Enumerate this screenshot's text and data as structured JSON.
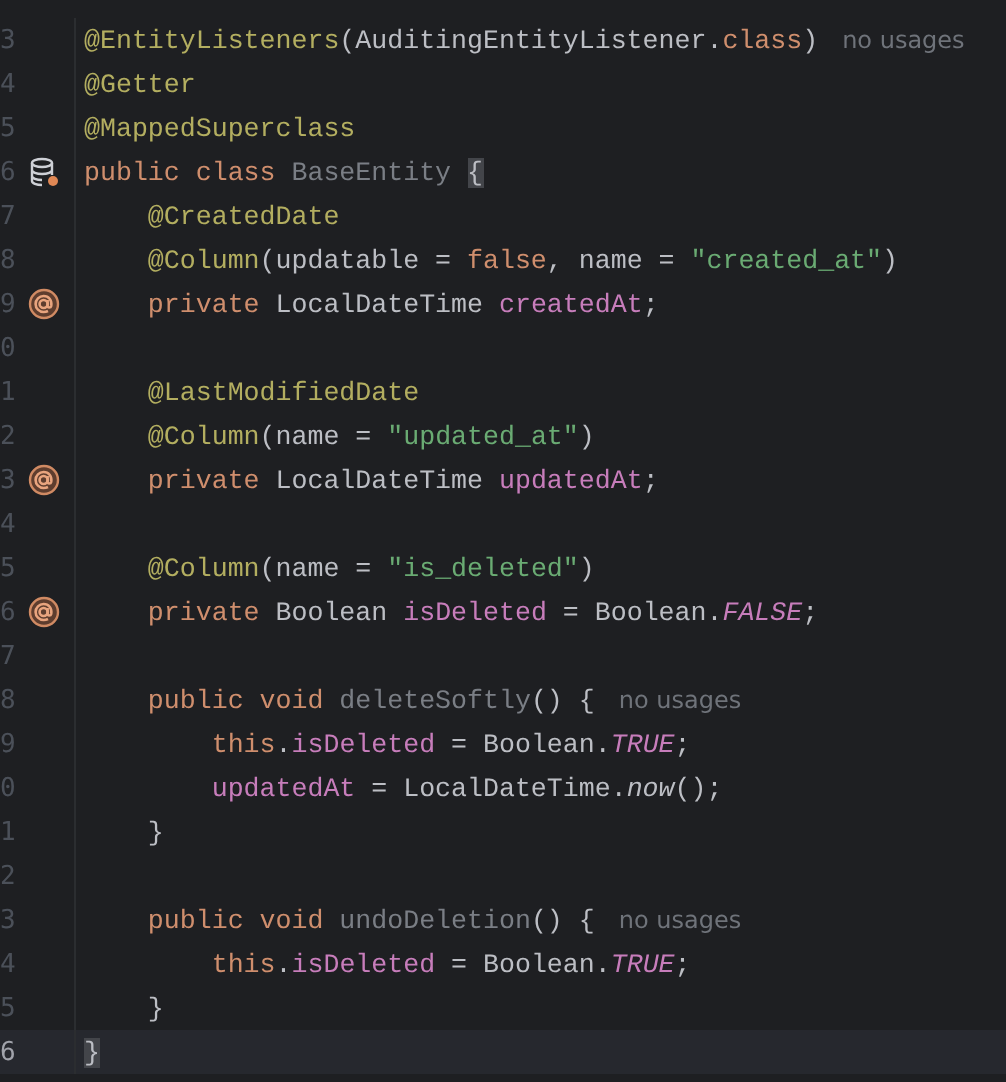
{
  "editor": {
    "lines": [
      {
        "number": "3",
        "current": false,
        "tokens": [
          {
            "kind": "annotation",
            "text": "@EntityListeners"
          },
          {
            "kind": "plain",
            "text": "(AuditingEntityListener."
          },
          {
            "kind": "keyword",
            "text": "class"
          },
          {
            "kind": "plain",
            "text": ")"
          }
        ],
        "hint": "no usages"
      },
      {
        "number": "4",
        "current": false,
        "tokens": [
          {
            "kind": "annotation",
            "text": "@Getter"
          }
        ]
      },
      {
        "number": "5",
        "current": false,
        "tokens": [
          {
            "kind": "annotation",
            "text": "@MappedSuperclass"
          }
        ]
      },
      {
        "number": "6",
        "current": false,
        "gutter_marker": {
          "kind": "database"
        },
        "tokens": [
          {
            "kind": "keyword",
            "text": "public class "
          },
          {
            "kind": "unused",
            "text": "BaseEntity "
          },
          {
            "kind": "brace_match",
            "text": "{"
          }
        ]
      },
      {
        "number": "7",
        "current": false,
        "tokens": [
          {
            "kind": "annotation",
            "text": "    @CreatedDate"
          }
        ]
      },
      {
        "number": "8",
        "current": false,
        "tokens": [
          {
            "kind": "annotation",
            "text": "    @Column"
          },
          {
            "kind": "plain",
            "text": "(updatable = "
          },
          {
            "kind": "keyword",
            "text": "false"
          },
          {
            "kind": "plain",
            "text": ", name = "
          },
          {
            "kind": "string",
            "text": "\"created_at\""
          },
          {
            "kind": "plain",
            "text": ")"
          }
        ]
      },
      {
        "number": "9",
        "current": false,
        "gutter_marker": {
          "kind": "annotated"
        },
        "tokens": [
          {
            "kind": "keyword",
            "text": "    private "
          },
          {
            "kind": "plain",
            "text": "LocalDateTime "
          },
          {
            "kind": "field",
            "text": "createdAt"
          },
          {
            "kind": "plain",
            "text": ";"
          }
        ]
      },
      {
        "number": "0",
        "current": false
      },
      {
        "number": "1",
        "current": false,
        "tokens": [
          {
            "kind": "annotation",
            "text": "    @LastModifiedDate"
          }
        ]
      },
      {
        "number": "2",
        "current": false,
        "tokens": [
          {
            "kind": "annotation",
            "text": "    @Column"
          },
          {
            "kind": "plain",
            "text": "(name = "
          },
          {
            "kind": "string",
            "text": "\"updated_at\""
          },
          {
            "kind": "plain",
            "text": ")"
          }
        ]
      },
      {
        "number": "3",
        "current": false,
        "gutter_marker": {
          "kind": "annotated"
        },
        "tokens": [
          {
            "kind": "keyword",
            "text": "    private "
          },
          {
            "kind": "plain",
            "text": "LocalDateTime "
          },
          {
            "kind": "field",
            "text": "updatedAt"
          },
          {
            "kind": "plain",
            "text": ";"
          }
        ]
      },
      {
        "number": "4",
        "current": false
      },
      {
        "number": "5",
        "current": false,
        "tokens": [
          {
            "kind": "annotation",
            "text": "    @Column"
          },
          {
            "kind": "plain",
            "text": "(name = "
          },
          {
            "kind": "string",
            "text": "\"is_deleted\""
          },
          {
            "kind": "plain",
            "text": ")"
          }
        ]
      },
      {
        "number": "6",
        "current": false,
        "gutter_marker": {
          "kind": "annotated"
        },
        "tokens": [
          {
            "kind": "keyword",
            "text": "    private "
          },
          {
            "kind": "plain",
            "text": "Boolean "
          },
          {
            "kind": "field",
            "text": "isDeleted"
          },
          {
            "kind": "plain",
            "text": " = Boolean."
          },
          {
            "kind": "constant",
            "text": "FALSE"
          },
          {
            "kind": "plain",
            "text": ";"
          }
        ]
      },
      {
        "number": "7",
        "current": false
      },
      {
        "number": "8",
        "current": false,
        "tokens": [
          {
            "kind": "keyword",
            "text": "    public void "
          },
          {
            "kind": "unused",
            "text": "deleteSoftly"
          },
          {
            "kind": "plain",
            "text": "() {"
          }
        ],
        "hint": "no usages"
      },
      {
        "number": "9",
        "current": false,
        "tokens": [
          {
            "kind": "keyword",
            "text": "        this"
          },
          {
            "kind": "plain",
            "text": "."
          },
          {
            "kind": "field",
            "text": "isDeleted"
          },
          {
            "kind": "plain",
            "text": " = Boolean."
          },
          {
            "kind": "constant",
            "text": "TRUE"
          },
          {
            "kind": "plain",
            "text": ";"
          }
        ]
      },
      {
        "number": "0",
        "current": false,
        "tokens": [
          {
            "kind": "field",
            "text": "        updatedAt"
          },
          {
            "kind": "plain",
            "text": " = LocalDateTime."
          },
          {
            "kind": "static_call",
            "text": "now"
          },
          {
            "kind": "plain",
            "text": "();"
          }
        ]
      },
      {
        "number": "1",
        "current": false,
        "tokens": [
          {
            "kind": "plain",
            "text": "    }"
          }
        ]
      },
      {
        "number": "2",
        "current": false
      },
      {
        "number": "3",
        "current": false,
        "tokens": [
          {
            "kind": "keyword",
            "text": "    public void "
          },
          {
            "kind": "unused",
            "text": "undoDeletion"
          },
          {
            "kind": "plain",
            "text": "() {"
          }
        ],
        "hint": "no usages"
      },
      {
        "number": "4",
        "current": false,
        "tokens": [
          {
            "kind": "keyword",
            "text": "        this"
          },
          {
            "kind": "plain",
            "text": "."
          },
          {
            "kind": "field",
            "text": "isDeleted"
          },
          {
            "kind": "plain",
            "text": " = Boolean."
          },
          {
            "kind": "constant",
            "text": "TRUE"
          },
          {
            "kind": "plain",
            "text": ";"
          }
        ]
      },
      {
        "number": "5",
        "current": false,
        "tokens": [
          {
            "kind": "plain",
            "text": "    }"
          }
        ]
      },
      {
        "number": "6",
        "current": true,
        "tokens": [
          {
            "kind": "brace_match",
            "text": "}"
          }
        ]
      }
    ]
  }
}
